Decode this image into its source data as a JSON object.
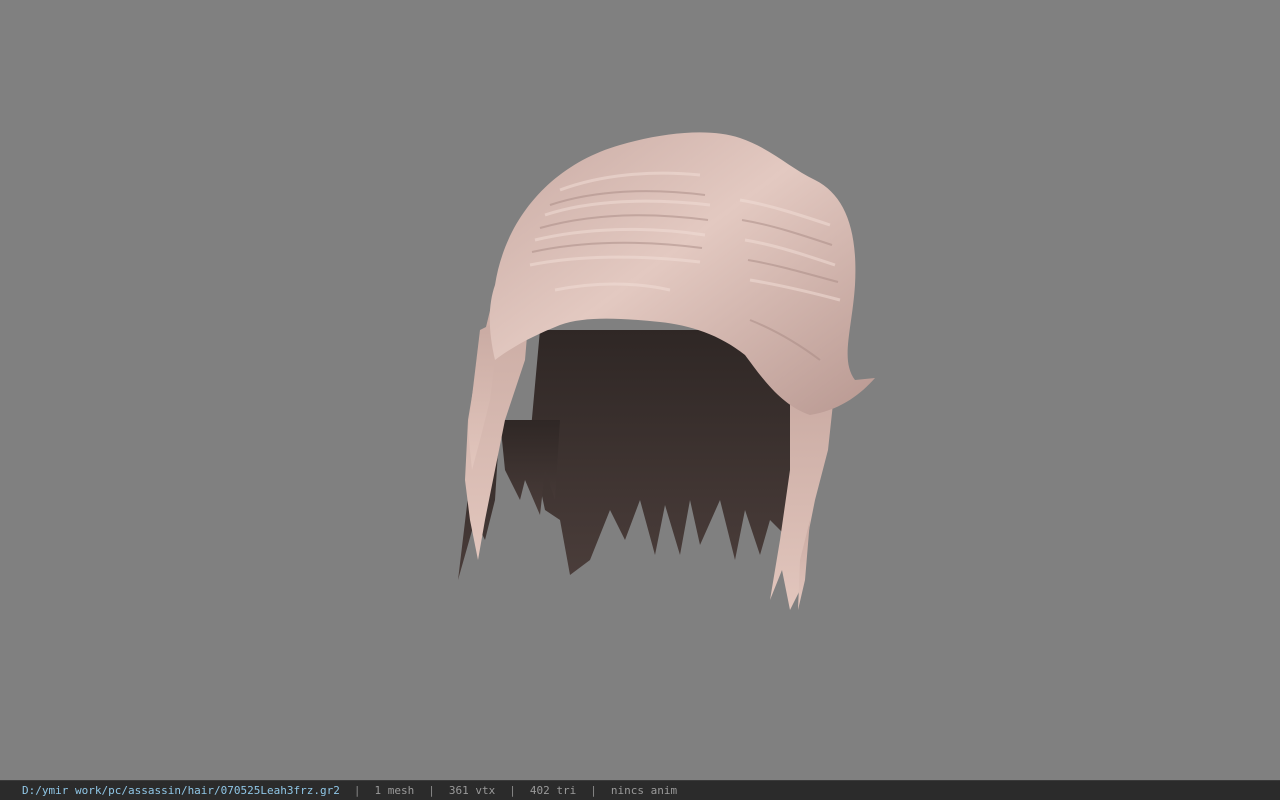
{
  "status_bar": {
    "file_path": "D:/ymir work/pc/assassin/hair/070525Leah3frz.gr2",
    "separator": "|",
    "mesh_count": "1 mesh",
    "vertex_count": "361 vtx",
    "triangle_count": "402 tri",
    "anim_info": "nincs anim"
  },
  "viewport": {
    "background_color": "#808080",
    "model_hair_color": "#d9bdb5",
    "model_inner_color": "#3a302e"
  }
}
